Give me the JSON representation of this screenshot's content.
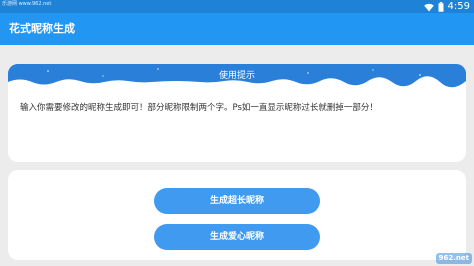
{
  "status_bar": {
    "site_text": "乐游网 www.962.net",
    "time": "4:59",
    "icons": [
      "wifi-icon",
      "battery-icon"
    ]
  },
  "toolbar": {
    "title": "花式昵称生成"
  },
  "tip": {
    "header": "使用提示",
    "body": "输入你需要修改的昵称生成即可！部分昵称限制两个字。Ps如一直显示昵称过长就删掉一部分！"
  },
  "actions": {
    "long_button": "生成超长昵称",
    "love_button": "生成爱心昵称"
  },
  "watermark": {
    "text": "962.net"
  },
  "colors": {
    "status_bar": "#1e83d6",
    "toolbar": "#2196f3",
    "tip_header": "#2a7fd9",
    "button": "#3f9af0",
    "background": "#ececec"
  }
}
